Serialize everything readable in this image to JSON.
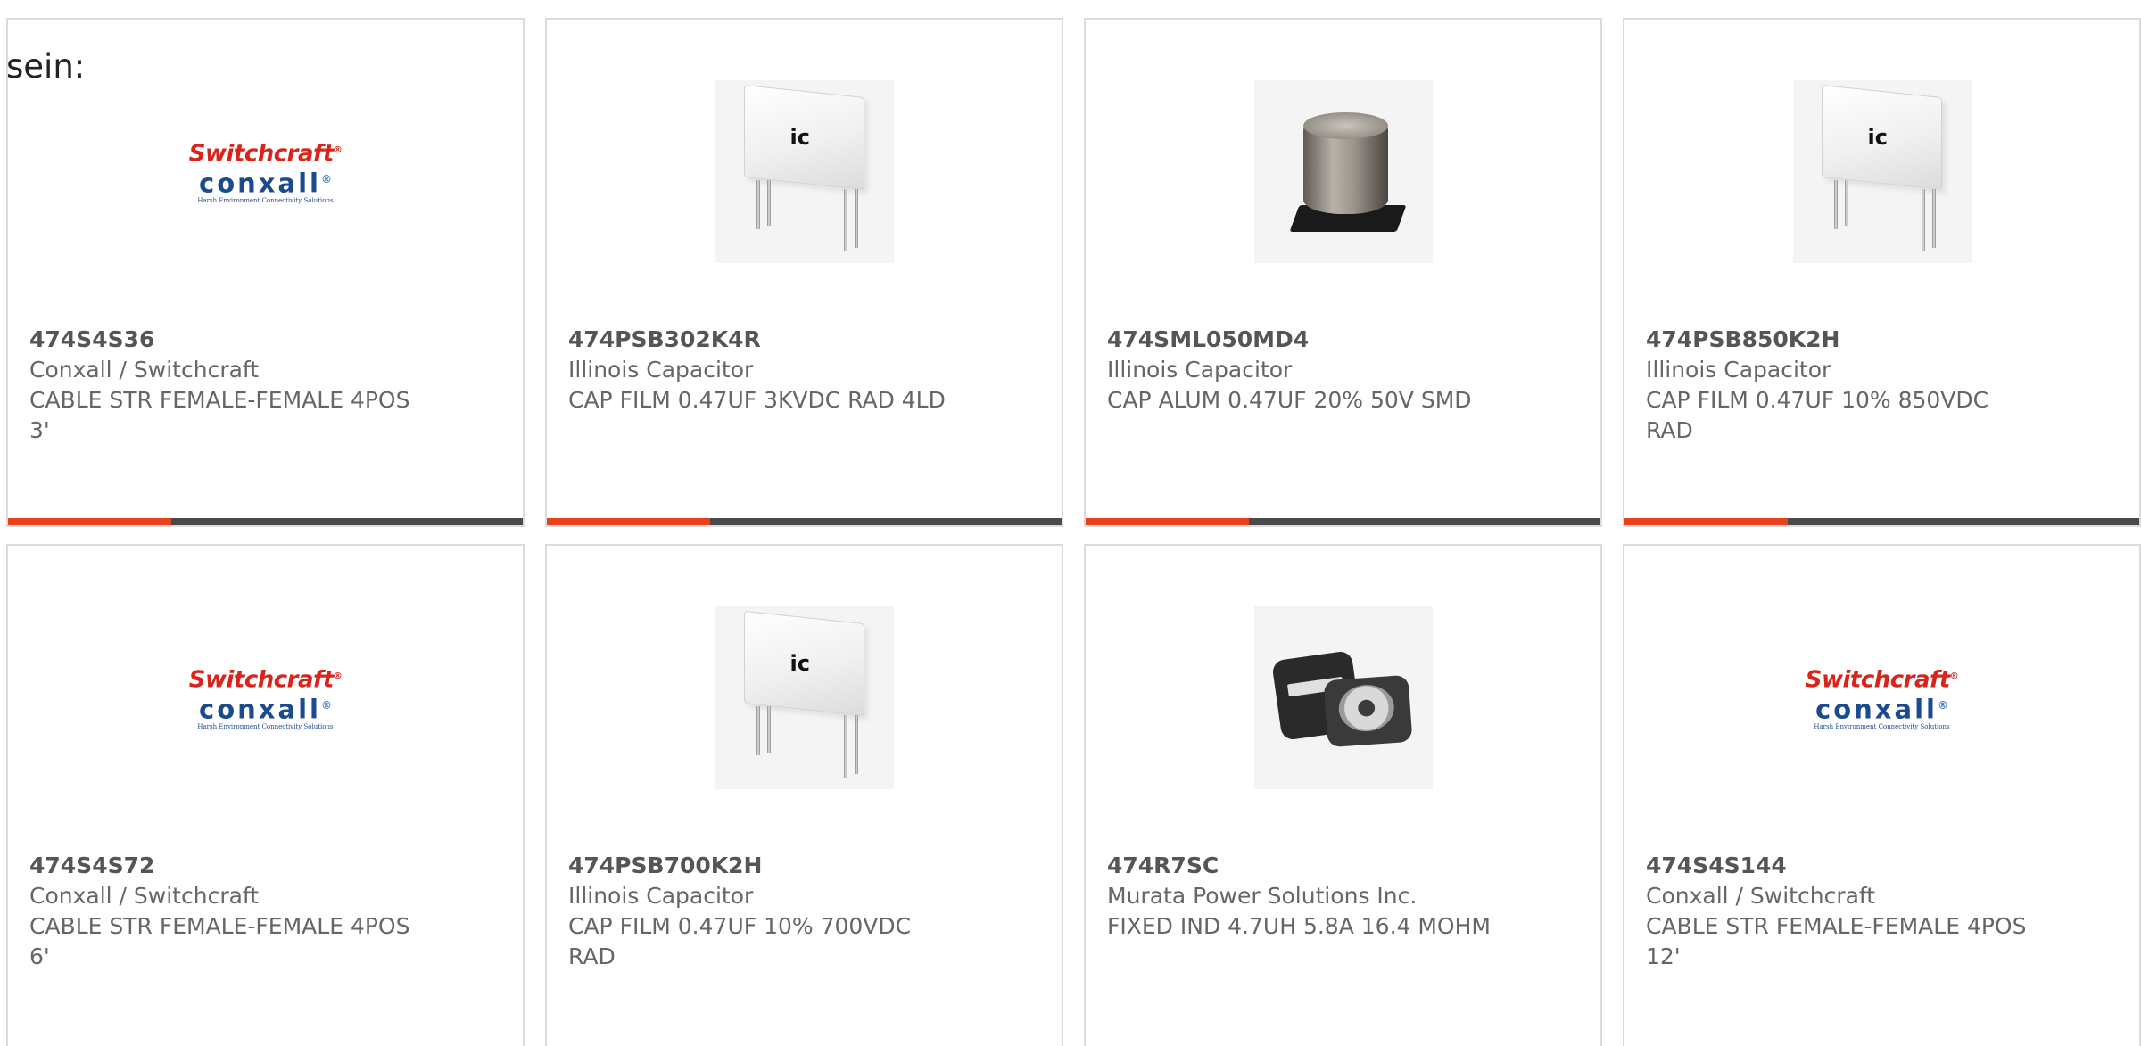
{
  "intro_text": "sein:",
  "colors": {
    "accent_bar": "#e8411c",
    "bar": "#4a4a4a",
    "card_border": "#dcdcdc"
  },
  "products": [
    {
      "part_number": "474S4S36",
      "manufacturer": "Conxall / Switchcraft",
      "description": "CABLE STR FEMALE-FEMALE 4POS 3'",
      "image": "switchcraft-conxall-logo"
    },
    {
      "part_number": "474PSB302K4R",
      "manufacturer": "Illinois Capacitor",
      "description": "CAP FILM 0.47UF 3KVDC RAD 4LD",
      "image": "film-capacitor-photo"
    },
    {
      "part_number": "474SML050MD4",
      "manufacturer": "Illinois Capacitor",
      "description": "CAP ALUM 0.47UF 20% 50V SMD",
      "image": "smd-electrolytic-capacitor-photo"
    },
    {
      "part_number": "474PSB850K2H",
      "manufacturer": "Illinois Capacitor",
      "description": "CAP FILM 0.47UF 10% 850VDC RAD",
      "image": "film-capacitor-photo"
    },
    {
      "part_number": "474S4S72",
      "manufacturer": "Conxall / Switchcraft",
      "description": "CABLE STR FEMALE-FEMALE 4POS 6'",
      "image": "switchcraft-conxall-logo"
    },
    {
      "part_number": "474PSB700K2H",
      "manufacturer": "Illinois Capacitor",
      "description": "CAP FILM 0.47UF 10% 700VDC RAD",
      "image": "film-capacitor-photo"
    },
    {
      "part_number": "474R7SC",
      "manufacturer": "Murata Power Solutions Inc.",
      "description": "FIXED IND 4.7UH 5.8A 16.4 MOHM",
      "image": "power-inductor-photo"
    },
    {
      "part_number": "474S4S144",
      "manufacturer": "Conxall / Switchcraft",
      "description": "CABLE STR FEMALE-FEMALE 4POS 12'",
      "image": "switchcraft-conxall-logo"
    }
  ],
  "logo": {
    "line1": "Switchcraft",
    "line1_mark": "®",
    "line2": "conxall",
    "line2_mark": "®",
    "tagline": "Harsh Environment Connectivity Solutions"
  },
  "film_capacitor_mark": "ic"
}
